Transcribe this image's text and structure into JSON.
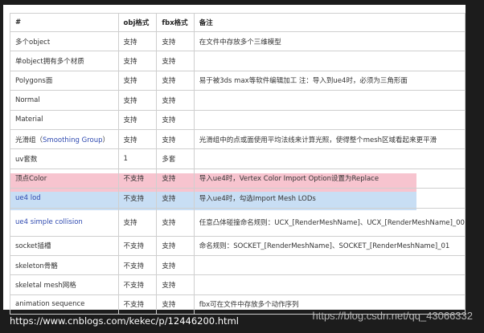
{
  "table": {
    "headers": [
      "#",
      "obj格式",
      "fbx格式",
      "备注"
    ],
    "rows": [
      {
        "feature": "多个object",
        "obj": "支持",
        "fbx": "支持",
        "note": "在文件中存放多个三维模型"
      },
      {
        "feature": "单object拥有多个材质",
        "obj": "支持",
        "fbx": "支持",
        "note": ""
      },
      {
        "feature": "Polygons面",
        "obj": "支持",
        "fbx": "支持",
        "note": "易于被3ds max等软件编辑加工   注：导入到ue4时，必须为三角形面"
      },
      {
        "feature": "Normal",
        "obj": "支持",
        "fbx": "支持",
        "note": ""
      },
      {
        "feature": "Material",
        "obj": "支持",
        "fbx": "支持",
        "note": ""
      },
      {
        "feature_prefix": "光滑组（",
        "feature_blue": "Smoothing Group",
        "feature_suffix": "）",
        "obj": "支持",
        "fbx": "支持",
        "note": "光滑组中的点或面使用平均法线来计算光照，使得整个mesh区域看起来更平滑"
      },
      {
        "feature": "uv套数",
        "obj": "1",
        "fbx": "多套",
        "note": ""
      },
      {
        "feature": "顶点Color",
        "obj": "不支持",
        "fbx": "支持",
        "note": "导入ue4时，Vertex Color Import Option设置为Replace",
        "highlight": "#f7c4cf"
      },
      {
        "feature": "ue4 lod",
        "obj": "不支持",
        "fbx": "支持",
        "note": "导入ue4时，勾选Import Mesh LODs",
        "highlight": "#c8def4"
      },
      {
        "feature": "ue4 simple collision",
        "obj": "支持",
        "fbx": "支持",
        "note": "任意凸体碰撞命名规则：UCX_[RenderMeshName]、UCX_[RenderMeshName]_00"
      },
      {
        "feature": "socket插槽",
        "obj": "不支持",
        "fbx": "支持",
        "note": "命名规则：SOCKET_[RenderMeshName]、SOCKET_[RenderMeshName]_01"
      },
      {
        "feature": "skeleton骨骼",
        "obj": "不支持",
        "fbx": "支持",
        "note": ""
      },
      {
        "feature": "skeletal mesh网格",
        "obj": "不支持",
        "fbx": "支持",
        "note": ""
      },
      {
        "feature": "animation sequence",
        "obj": "不支持",
        "fbx": "支持",
        "note": "fbx可在文件中存放多个动作序列"
      }
    ]
  },
  "footer": {
    "url": "https://www.cnblogs.com/kekec/p/12446200.html",
    "watermark": "https://blog.csdn.net/qq_43066332"
  },
  "colors": {
    "pink_highlight": "#f7c4cf",
    "blue_highlight": "#c8def4",
    "blue_text": "#2f4ab0",
    "background": "#1c1c1c"
  }
}
